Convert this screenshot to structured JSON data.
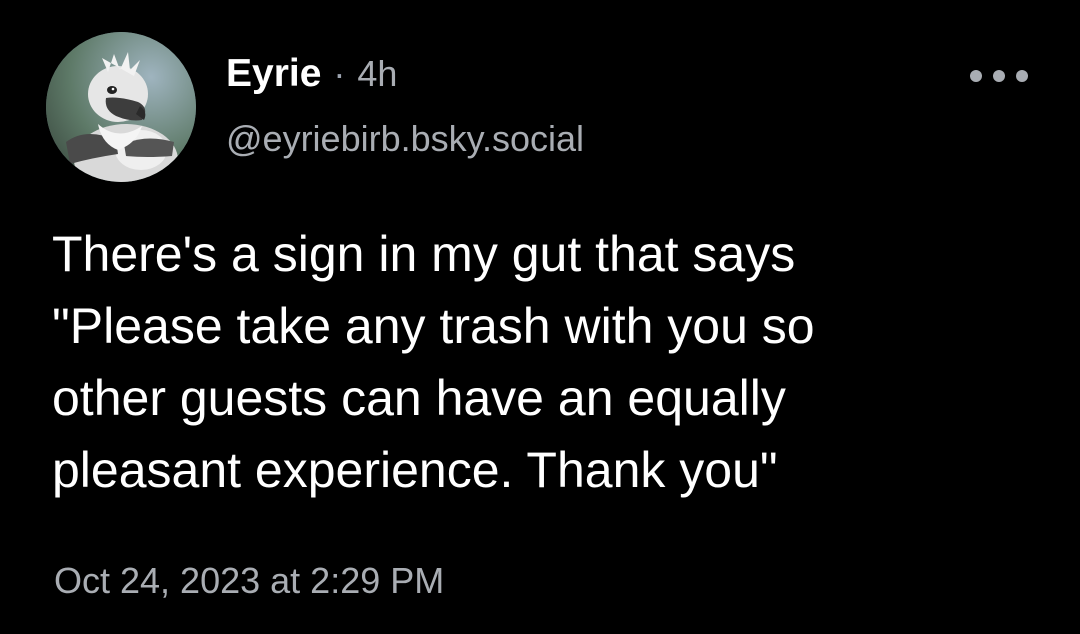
{
  "post": {
    "author": {
      "display_name": "Eyrie",
      "separator": "·",
      "time_ago": "4h",
      "handle": "@eyriebirb.bsky.social",
      "avatar_icon": "gryphon-avatar-icon"
    },
    "more_icon": "ellipsis-icon",
    "text": "There's a sign in my gut that says\n\"Please take any trash with you so\nother guests can have an equally\npleasant experience. Thank you\"",
    "timestamp": "Oct 24, 2023 at 2:29 PM"
  },
  "colors": {
    "background": "#000000",
    "primary_text": "#ffffff",
    "secondary_text": "#a9adb3"
  }
}
